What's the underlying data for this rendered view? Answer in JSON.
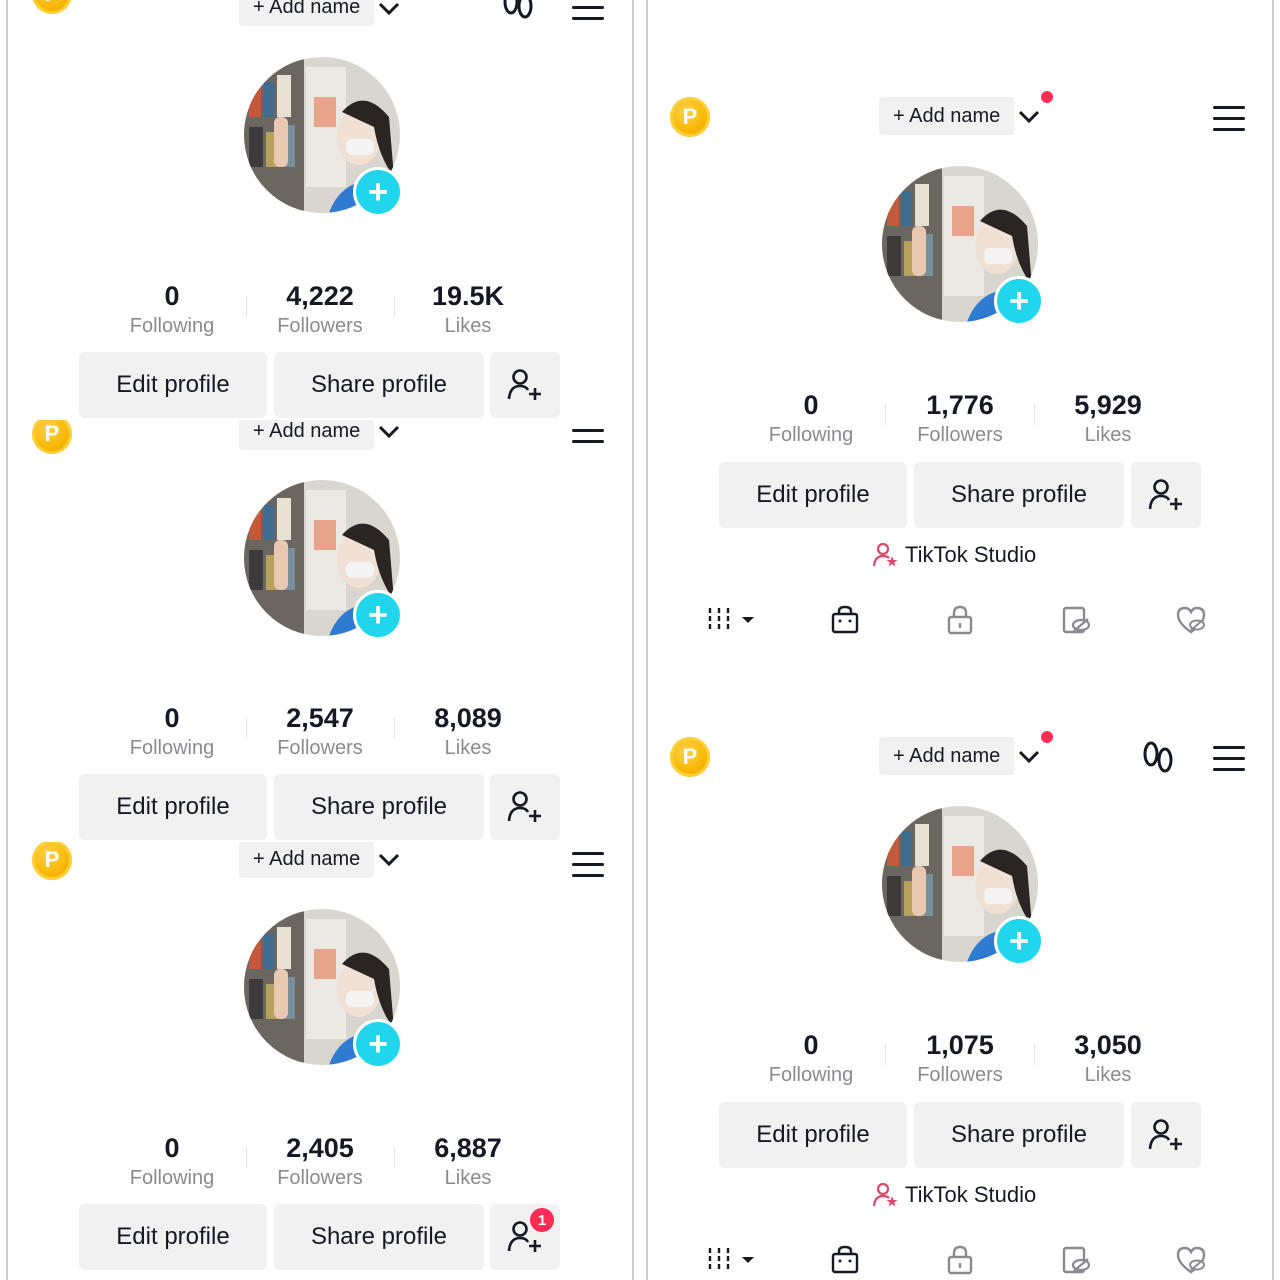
{
  "colors": {
    "accent": "#20d5ec",
    "coin": "#f7b500",
    "notify": "#fe2c55",
    "button_bg": "#f1f1f2",
    "muted_text": "#8a8b91"
  },
  "header": {
    "coin_letter": "P",
    "add_name_label": "+ Add name",
    "icons": [
      "coin-icon",
      "chevron-down-icon",
      "footprints-icon",
      "menu-icon"
    ]
  },
  "labels": {
    "following": "Following",
    "followers": "Followers",
    "likes": "Likes",
    "edit_profile": "Edit profile",
    "share_profile": "Share profile",
    "tiktok_studio": "TikTok Studio"
  },
  "panels": [
    {
      "following": "0",
      "followers": "4,222",
      "likes": "19.5K"
    },
    {
      "following": "0",
      "followers": "2,547",
      "likes": "8,089"
    },
    {
      "following": "0",
      "followers": "2,405",
      "likes": "6,887",
      "add_friend_badge": "1"
    },
    {
      "following": "0",
      "followers": "1,776",
      "likes": "5,929"
    },
    {
      "following": "0",
      "followers": "1,075",
      "likes": "3,050"
    }
  ],
  "tab_icons": [
    "grid-icon",
    "shop-bag-icon",
    "lock-icon",
    "repost-icon",
    "liked-icon"
  ]
}
